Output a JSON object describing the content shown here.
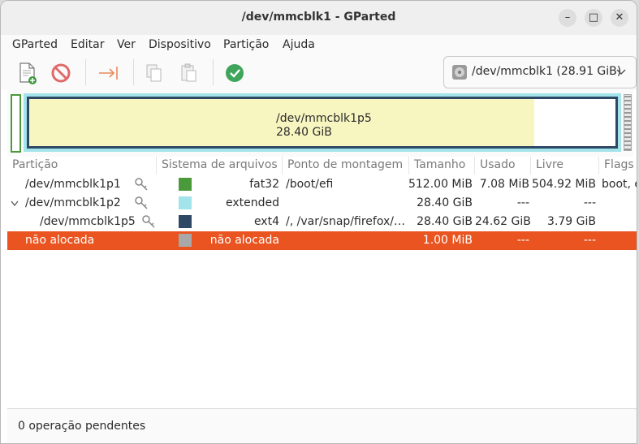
{
  "window": {
    "title": "/dev/mmcblk1 - GParted"
  },
  "menubar": {
    "items": [
      "GParted",
      "Editar",
      "Ver",
      "Dispositivo",
      "Partição",
      "Ajuda"
    ]
  },
  "toolbar": {
    "buttons": [
      "new-partition",
      "delete",
      "resize-move",
      "copy",
      "paste",
      "apply"
    ],
    "device_selector": "/dev/mmcblk1 (28.91 GiB)"
  },
  "diskmap": {
    "main_label": "/dev/mmcblk1p5",
    "main_size": "28.40 GiB",
    "colors": {
      "fat32": "#4a9a3c",
      "extended": "#a3e3ea",
      "ext4": "#2f4866",
      "used": "#f7f6c0",
      "unallocated": "#a8a8a8"
    }
  },
  "table": {
    "columns": [
      "Partição",
      "Sistema de arquivos",
      "Ponto de montagem",
      "Tamanho",
      "Usado",
      "Livre",
      "Flags"
    ],
    "rows": [
      {
        "partition": "/dev/mmcblk1p1",
        "fs": "fat32",
        "mount": "/boot/efi",
        "size": "512.00 MiB",
        "used": "7.08 MiB",
        "free": "504.92 MiB",
        "flags": "boot, esp",
        "color": "#4a9a3c"
      },
      {
        "partition": "/dev/mmcblk1p2",
        "fs": "extended",
        "mount": "",
        "size": "28.40 GiB",
        "used": "---",
        "free": "---",
        "flags": "",
        "color": "#a3e3ea"
      },
      {
        "partition": "/dev/mmcblk1p5",
        "fs": "ext4",
        "mount": "/, /var/snap/firefox/…",
        "size": "28.40 GiB",
        "used": "24.62 GiB",
        "free": "3.79 GiB",
        "flags": "",
        "color": "#2f4866"
      },
      {
        "partition": "não alocada",
        "fs": "não alocada",
        "mount": "",
        "size": "1.00 MiB",
        "used": "---",
        "free": "---",
        "flags": "",
        "color": "#a8a8a8"
      }
    ]
  },
  "status": {
    "text": "0 operação pendentes"
  }
}
